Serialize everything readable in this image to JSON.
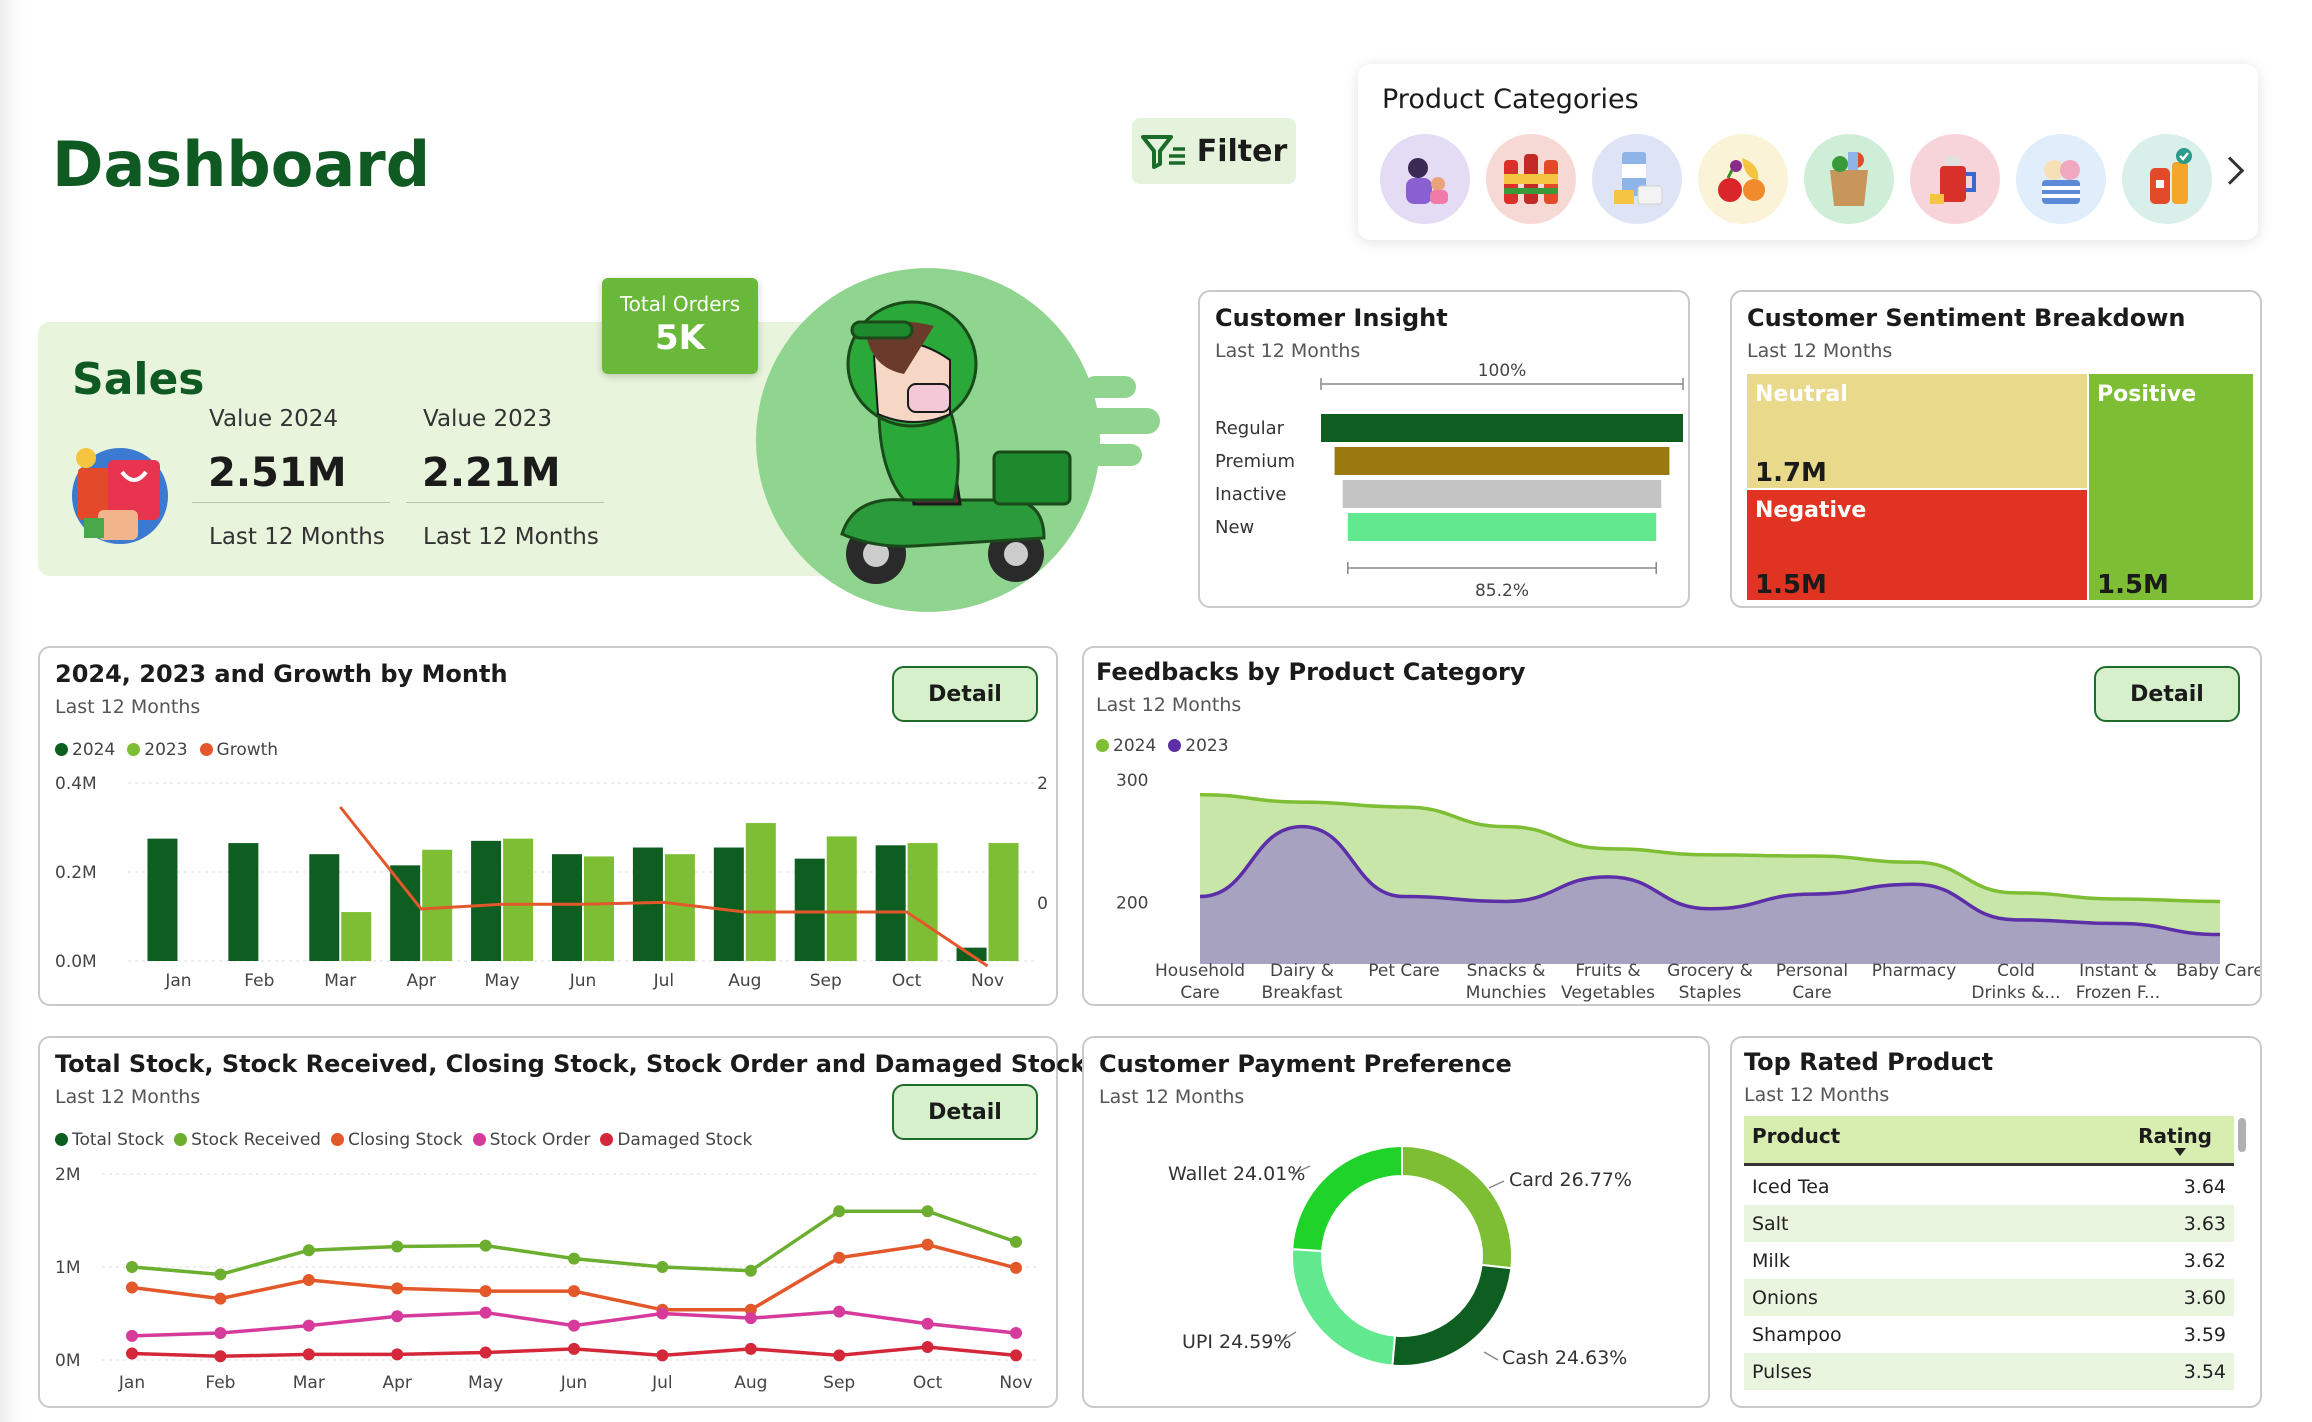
{
  "header": {
    "title": "Dashboard",
    "filter_label": "Filter"
  },
  "categories": {
    "title": "Product Categories",
    "icons": [
      "mother-baby-icon",
      "cold-drinks-icon",
      "dairy-icon",
      "fruits-vegetables-icon",
      "grocery-bag-icon",
      "pharmacy-cup-icon",
      "ice-cream-icon",
      "personal-care-icon"
    ]
  },
  "sales": {
    "title": "Sales",
    "total_orders_label": "Total Orders",
    "total_orders_value": "5K",
    "label_2024": "Value 2024",
    "value_2024": "2.51M",
    "period_2024": "Last 12 Months",
    "label_2023": "Value 2023",
    "value_2023": "2.21M",
    "period_2023": "Last 12 Months"
  },
  "insight": {
    "title": "Customer Insight",
    "subtitle": "Last 12 Months",
    "top_label": "100%",
    "bottom_label": "85.2%",
    "chart_data": {
      "type": "funnel",
      "categories": [
        "Regular",
        "Premium",
        "Inactive",
        "New"
      ],
      "values": [
        100,
        92.5,
        88,
        85.2
      ],
      "colors": [
        "#0e5e22",
        "#9a7a0e",
        "#c4c4c4",
        "#62e88e"
      ]
    }
  },
  "sentiment": {
    "title": "Customer Sentiment Breakdown",
    "subtitle": "Last 12 Months",
    "chart_data": {
      "type": "treemap",
      "items": [
        {
          "name": "Neutral",
          "value_label": "1.7M",
          "color": "#e9d98b"
        },
        {
          "name": "Positive",
          "value_label": "1.5M",
          "color": "#7dbe34"
        },
        {
          "name": "Negative",
          "value_label": "1.5M",
          "color": "#e03321"
        }
      ]
    }
  },
  "growth": {
    "title": "2024, 2023 and Growth by Month",
    "subtitle": "Last 12 Months",
    "detail_label": "Detail",
    "legend": [
      "2024",
      "2023",
      "Growth"
    ],
    "chart_data": {
      "type": "bar",
      "categories": [
        "Jan",
        "Feb",
        "Mar",
        "Apr",
        "May",
        "Jun",
        "Jul",
        "Aug",
        "Sep",
        "Oct",
        "Nov"
      ],
      "series": [
        {
          "name": "2024",
          "values": [
            0.275,
            0.265,
            0.24,
            0.215,
            0.27,
            0.24,
            0.255,
            0.255,
            0.23,
            0.26,
            0.03
          ],
          "color": "#0e5e22"
        },
        {
          "name": "2023",
          "values": [
            null,
            null,
            0.11,
            0.25,
            0.275,
            0.235,
            0.24,
            0.31,
            0.28,
            0.265,
            0.265
          ],
          "color": "#7dbe34"
        },
        {
          "name": "Growth",
          "values": [
            null,
            null,
            1.6,
            -0.1,
            -0.02,
            -0.02,
            0.01,
            -0.15,
            -0.15,
            -0.15,
            -1.2
          ],
          "color": "#e2582a"
        }
      ],
      "ylim": [
        0,
        0.4
      ],
      "y_ticks": [
        "0.0M",
        "0.2M",
        "0.4M"
      ],
      "y2_ticks": [
        "0",
        "2"
      ]
    }
  },
  "feedback": {
    "title": "Feedbacks by Product Category",
    "subtitle": "Last 12 Months",
    "detail_label": "Detail",
    "legend": [
      "2024",
      "2023"
    ],
    "chart_data": {
      "type": "area",
      "categories": [
        "Household Care",
        "Dairy & Breakfast",
        "Pet Care",
        "Snacks & Munchies",
        "Fruits & Vegetables",
        "Grocery & Staples",
        "Personal Care",
        "Pharmacy",
        "Cold Drinks &...",
        "Instant & Frozen F...",
        "Baby Care"
      ],
      "series": [
        {
          "name": "2024",
          "values": [
            288,
            282,
            278,
            262,
            244,
            239,
            238,
            233,
            208,
            203,
            201
          ],
          "color": "#7dbe34"
        },
        {
          "name": "2023",
          "values": [
            205,
            262,
            205,
            201,
            221,
            195,
            207,
            215,
            186,
            183,
            174
          ],
          "color": "#5c2ea8"
        }
      ],
      "ylim": [
        150,
        300
      ],
      "y_ticks": [
        "200",
        "300"
      ]
    }
  },
  "stock": {
    "title": "Total Stock, Stock Received, Closing Stock, Stock Order and Damaged Stock by Month",
    "subtitle": "Last 12 Months",
    "detail_label": "Detail",
    "legend": [
      "Total Stock",
      "Stock Received",
      "Closing Stock",
      "Stock Order",
      "Damaged Stock"
    ],
    "chart_data": {
      "type": "line",
      "categories": [
        "Jan",
        "Feb",
        "Mar",
        "Apr",
        "May",
        "Jun",
        "Jul",
        "Aug",
        "Sep",
        "Oct",
        "Nov"
      ],
      "series": [
        {
          "name": "Total Stock",
          "values": [
            null,
            null,
            null,
            null,
            null,
            null,
            null,
            null,
            null,
            null,
            null
          ],
          "color": "#0e5e22"
        },
        {
          "name": "Stock Received",
          "values": [
            1.0,
            0.92,
            1.18,
            1.22,
            1.23,
            1.09,
            1.0,
            0.96,
            1.6,
            1.6,
            1.27
          ],
          "color": "#6cae2f"
        },
        {
          "name": "Closing Stock",
          "values": [
            0.78,
            0.66,
            0.86,
            0.77,
            0.74,
            0.74,
            0.54,
            0.54,
            1.1,
            1.24,
            0.99
          ],
          "color": "#e2582a"
        },
        {
          "name": "Stock Order",
          "values": [
            0.26,
            0.29,
            0.37,
            0.47,
            0.51,
            0.37,
            0.5,
            0.45,
            0.52,
            0.39,
            0.29
          ],
          "color": "#d63a9a"
        },
        {
          "name": "Damaged Stock",
          "values": [
            0.07,
            0.04,
            0.06,
            0.06,
            0.08,
            0.12,
            0.05,
            0.12,
            0.05,
            0.14,
            0.05
          ],
          "color": "#d4283a"
        }
      ],
      "ylim": [
        0,
        2
      ],
      "y_ticks": [
        "0M",
        "1M",
        "2M"
      ]
    }
  },
  "payment": {
    "title": "Customer Payment Preference",
    "subtitle": "Last 12 Months",
    "chart_data": {
      "type": "pie",
      "slices": [
        {
          "name": "Card",
          "value": 26.77,
          "label": "Card 26.77%",
          "color": "#7dbe34"
        },
        {
          "name": "Cash",
          "value": 24.63,
          "label": "Cash 24.63%",
          "color": "#0e5e22"
        },
        {
          "name": "UPI",
          "value": 24.59,
          "label": "UPI 24.59%",
          "color": "#62e88e"
        },
        {
          "name": "Wallet",
          "value": 24.01,
          "label": "Wallet 24.01%",
          "color": "#1fd32a"
        }
      ]
    }
  },
  "top_rated": {
    "title": "Top Rated Product",
    "subtitle": "Last 12 Months",
    "col_product": "Product",
    "col_rating": "Rating",
    "rows": [
      {
        "product": "Iced Tea",
        "rating": "3.64"
      },
      {
        "product": "Salt",
        "rating": "3.63"
      },
      {
        "product": "Milk",
        "rating": "3.62"
      },
      {
        "product": "Onions",
        "rating": "3.60"
      },
      {
        "product": "Shampoo",
        "rating": "3.59"
      },
      {
        "product": "Pulses",
        "rating": "3.54"
      }
    ]
  }
}
